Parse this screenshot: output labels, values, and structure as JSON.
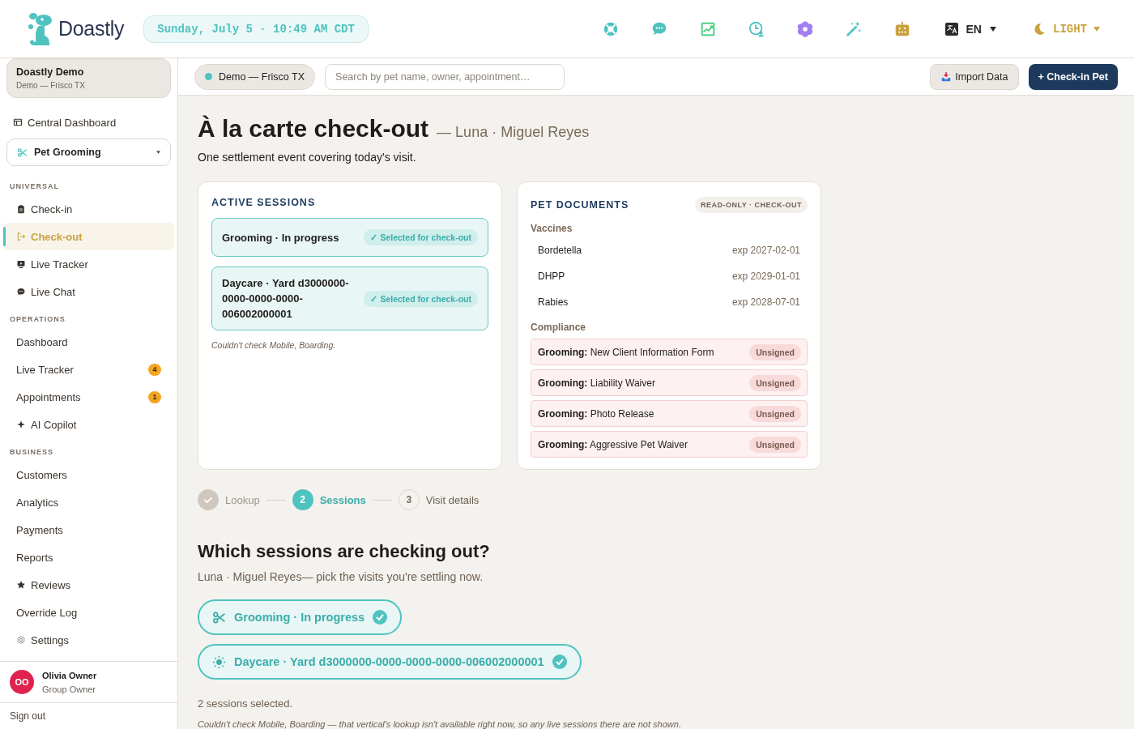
{
  "header": {
    "brand": "Doastly",
    "datetime": "Sunday, July 5 · 10:49 AM CDT",
    "language": "EN",
    "theme": "LIGHT"
  },
  "sidebar": {
    "org": {
      "name": "Doastly Demo",
      "location": "Demo — Frisco TX"
    },
    "top_item": {
      "label": "Central Dashboard",
      "kind": "layout"
    },
    "vertical_select": "Pet Grooming",
    "sections": [
      {
        "title": "UNIVERSAL",
        "items": [
          {
            "label": "Check-in",
            "kind": "clipboard",
            "selected": false
          },
          {
            "label": "Check-out",
            "kind": "exit",
            "selected": true
          },
          {
            "label": "Live Tracker",
            "kind": "monitor",
            "selected": false
          },
          {
            "label": "Live Chat",
            "kind": "chat",
            "selected": false
          }
        ]
      },
      {
        "title": "OPERATIONS",
        "items": [
          {
            "label": "Dashboard",
            "selected": false
          },
          {
            "label": "Live Tracker",
            "badge": "4",
            "selected": false
          },
          {
            "label": "Appointments",
            "badge": "1",
            "selected": false
          },
          {
            "label": "AI Copilot",
            "kind": "sparkle",
            "selected": false
          }
        ]
      },
      {
        "title": "BUSINESS",
        "items": [
          {
            "label": "Customers",
            "selected": false
          },
          {
            "label": "Analytics",
            "selected": false
          },
          {
            "label": "Payments",
            "selected": false
          },
          {
            "label": "Reports",
            "selected": false
          },
          {
            "label": "Reviews",
            "kind": "star",
            "selected": false
          },
          {
            "label": "Override Log",
            "selected": false
          },
          {
            "label": "Settings",
            "kind": "gear",
            "selected": false
          }
        ]
      }
    ],
    "user": {
      "initials": "OO",
      "name": "Olivia Owner",
      "role": "Group Owner"
    },
    "sign_out": "Sign out"
  },
  "toolbar": {
    "location": "Demo — Frisco TX",
    "search_placeholder": "Search by pet name, owner, appointment…",
    "import_button": "Import Data",
    "checkin_button": "+ Check-in Pet"
  },
  "page": {
    "title": "À la carte check-out",
    "subtitle": "— Luna · Miguel Reyes",
    "description": "One settlement event covering today's visit."
  },
  "active_sessions": {
    "title": "ACTIVE SESSIONS",
    "sessions": [
      {
        "label": "Grooming · In progress",
        "status": "✓ Selected for check-out",
        "selected": true
      },
      {
        "label": "Daycare · Yard d3000000-0000-0000-0000-006002000001",
        "status": "✓ Selected for check-out",
        "selected": true
      }
    ],
    "note": "Couldn't check Mobile, Boarding."
  },
  "pet_documents": {
    "title": "PET DOCUMENTS",
    "badge": "READ-ONLY · CHECK-OUT",
    "vaccines_heading": "Vaccines",
    "vaccines": [
      {
        "name": "Bordetella",
        "expires": "exp 2027-02-01"
      },
      {
        "name": "DHPP",
        "expires": "exp 2029-01-01"
      },
      {
        "name": "Rabies",
        "expires": "exp 2028-07-01"
      }
    ],
    "compliance_heading": "Compliance",
    "compliance": [
      {
        "category": "Grooming:",
        "name": "New Client Information Form",
        "status": "Unsigned"
      },
      {
        "category": "Grooming:",
        "name": "Liability Waiver",
        "status": "Unsigned"
      },
      {
        "category": "Grooming:",
        "name": "Photo Release",
        "status": "Unsigned"
      },
      {
        "category": "Grooming:",
        "name": "Aggressive Pet Waiver",
        "status": "Unsigned"
      }
    ]
  },
  "stepper": [
    {
      "label": "Lookup",
      "completed": true,
      "selected": false
    },
    {
      "number": "2",
      "label": "Sessions",
      "completed": false,
      "selected": true
    },
    {
      "number": "3",
      "label": "Visit details",
      "completed": false,
      "selected": false
    }
  ],
  "selection": {
    "heading": "Which sessions are checking out?",
    "subheading": "Luna · Miguel Reyes— pick the visits you're settling now.",
    "options": [
      {
        "kind": "scissors",
        "label": "Grooming · In progress",
        "selected": true
      },
      {
        "kind": "sun",
        "label": "Daycare · Yard d3000000-0000-0000-0000-006002000001",
        "selected": true
      }
    ],
    "summary": "2 sessions selected.",
    "note": "Couldn't check Mobile, Boarding — that vertical's lookup isn't available right now, so any live sessions there are not shown."
  }
}
